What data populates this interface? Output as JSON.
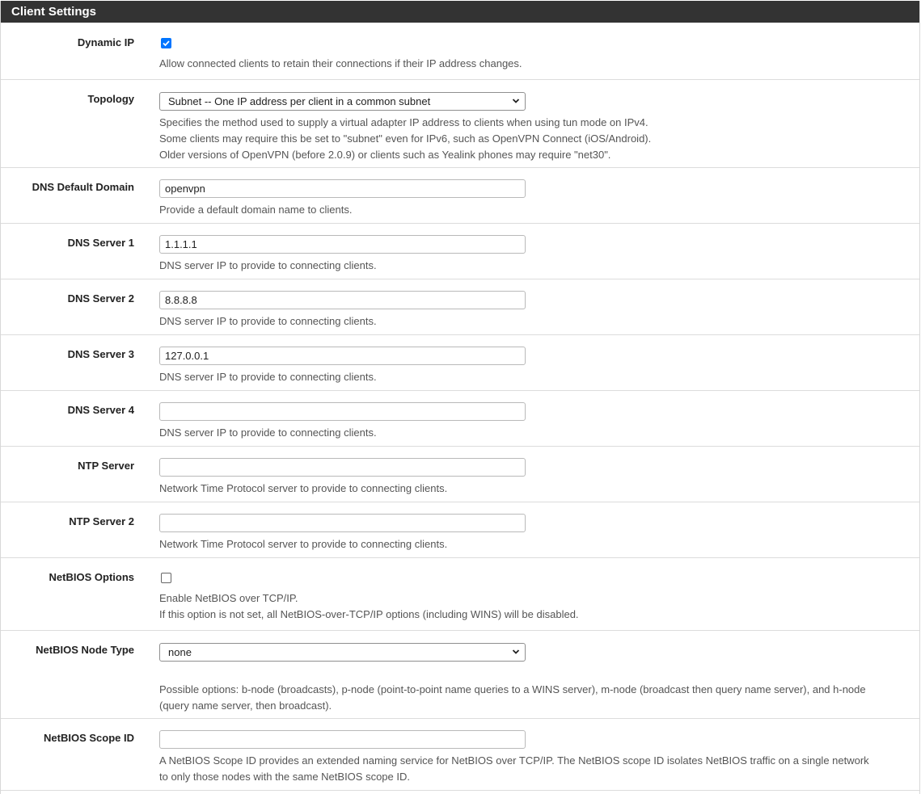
{
  "section_title": "Client Settings",
  "dynamic_ip": {
    "label": "Dynamic IP",
    "checked": true,
    "help": "Allow connected clients to retain their connections if their IP address changes."
  },
  "topology": {
    "label": "Topology",
    "value": "Subnet -- One IP address per client in a common subnet",
    "help": [
      "Specifies the method used to supply a virtual adapter IP address to clients when using tun mode on IPv4.",
      "Some clients may require this be set to \"subnet\" even for IPv6, such as OpenVPN Connect (iOS/Android).",
      "Older versions of OpenVPN (before 2.0.9) or clients such as Yealink phones may require \"net30\"."
    ]
  },
  "dns_default_domain": {
    "label": "DNS Default Domain",
    "value": "openvpn",
    "help": "Provide a default domain name to clients."
  },
  "dns_server_1": {
    "label": "DNS Server 1",
    "value": "1.1.1.1",
    "help": "DNS server IP to provide to connecting clients."
  },
  "dns_server_2": {
    "label": "DNS Server 2",
    "value": "8.8.8.8",
    "help": "DNS server IP to provide to connecting clients."
  },
  "dns_server_3": {
    "label": "DNS Server 3",
    "value": "127.0.0.1",
    "help": "DNS server IP to provide to connecting clients."
  },
  "dns_server_4": {
    "label": "DNS Server 4",
    "value": "",
    "help": "DNS server IP to provide to connecting clients."
  },
  "ntp_server": {
    "label": "NTP Server",
    "value": "",
    "help": "Network Time Protocol server to provide to connecting clients."
  },
  "ntp_server_2": {
    "label": "NTP Server 2",
    "value": "",
    "help": "Network Time Protocol server to provide to connecting clients."
  },
  "netbios_options": {
    "label": "NetBIOS Options",
    "checked": false,
    "help": [
      "Enable NetBIOS over TCP/IP.",
      "If this option is not set, all NetBIOS-over-TCP/IP options (including WINS) will be disabled."
    ]
  },
  "netbios_node_type": {
    "label": "NetBIOS Node Type",
    "value": "none",
    "help": [
      "Possible options: b-node (broadcasts), p-node (point-to-point name queries to a WINS server), m-node (broadcast then query name server), and h-node",
      "(query name server, then broadcast)."
    ]
  },
  "netbios_scope_id": {
    "label": "NetBIOS Scope ID",
    "value": "",
    "help": [
      "A NetBIOS Scope ID provides an extended naming service for NetBIOS over TCP/IP. The NetBIOS scope ID isolates NetBIOS traffic on a single network",
      "to only those nodes with the same NetBIOS scope ID."
    ]
  }
}
